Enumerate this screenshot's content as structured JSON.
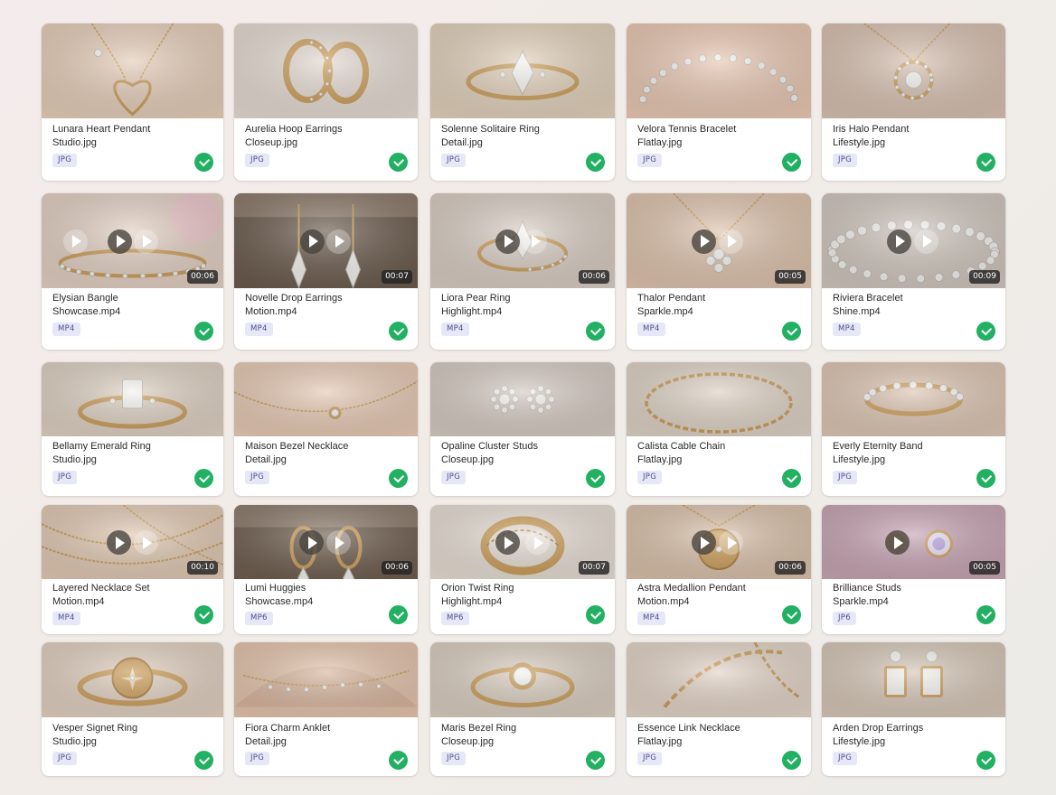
{
  "items": [
    {
      "title": "Lunara Heart Pendant",
      "file": "Studio.jpg",
      "badge": "JPG",
      "video": false,
      "duration": "",
      "bg": "#e5cdb8",
      "motif": "heart"
    },
    {
      "title": "Aurelia Hoop Earrings",
      "file": "Closeup.jpg",
      "badge": "JPG",
      "video": false,
      "duration": "",
      "bg": "#e4dad1",
      "motif": "hoops"
    },
    {
      "title": "Solenne Solitaire Ring",
      "file": "Detail.jpg",
      "badge": "JPG",
      "video": false,
      "duration": "",
      "bg": "#e1d0ba",
      "motif": "ring-marquise"
    },
    {
      "title": "Velora Tennis Bracelet",
      "file": "Flatlay.jpg",
      "badge": "JPG",
      "video": false,
      "duration": "",
      "bg": "#e8c7b2",
      "motif": "bracelet-arc"
    },
    {
      "title": "Iris Halo Pendant",
      "file": "Lifestyle.jpg",
      "badge": "JPG",
      "video": false,
      "duration": "",
      "bg": "#d7c0b0",
      "motif": "halo-pendant"
    },
    {
      "title": "Elysian Bangle",
      "file": "Showcase.mp4",
      "badge": "MP4",
      "video": true,
      "duration": "00:06",
      "bg": "#e2cfc2",
      "motif": "bangle",
      "plays": [
        24,
        73,
        102
      ],
      "ghost": [
        0,
        2
      ]
    },
    {
      "title": "Novelle Drop Earrings",
      "file": "Motion.mp4",
      "badge": "MP4",
      "video": true,
      "duration": "00:07",
      "bg": "#6a5a4c",
      "motif": "drop-earrings",
      "plays": [
        73,
        102
      ],
      "ghost": [
        1
      ]
    },
    {
      "title": "Liora Pear Ring",
      "file": "Highlight.mp4",
      "badge": "MP4",
      "video": true,
      "duration": "00:06",
      "bg": "#d8ccc2",
      "motif": "ring-pear",
      "plays": [
        72,
        102
      ],
      "ghost": [
        1
      ]
    },
    {
      "title": "Thalor Pendant",
      "file": "Sparkle.mp4",
      "badge": "MP4",
      "video": true,
      "duration": "00:05",
      "bg": "#ddc2ac",
      "motif": "flower-pendant",
      "plays": [
        72,
        102
      ],
      "ghost": [
        1
      ]
    },
    {
      "title": "Riviera Bracelet",
      "file": "Shine.mp4",
      "badge": "MP4",
      "video": true,
      "duration": "00:09",
      "bg": "#cfc6bd",
      "motif": "bracelet-round",
      "plays": [
        72,
        102
      ],
      "ghost": [
        1
      ]
    },
    {
      "title": "Bellamy Emerald Ring",
      "file": "Studio.jpg",
      "badge": "JPG",
      "video": false,
      "duration": "",
      "bg": "#ddd0c1",
      "motif": "ring-emerald"
    },
    {
      "title": "Maison Bezel Necklace",
      "file": "Detail.jpg",
      "badge": "JPG",
      "video": false,
      "duration": "",
      "bg": "#e6c9b4",
      "motif": "bezel-necklace"
    },
    {
      "title": "Opaline Cluster Studs",
      "file": "Closeup.jpg",
      "badge": "JPG",
      "video": false,
      "duration": "",
      "bg": "#d4cac1",
      "motif": "cluster-studs"
    },
    {
      "title": "Calista Cable Chain",
      "file": "Flatlay.jpg",
      "badge": "JPG",
      "video": false,
      "duration": "",
      "bg": "#ddd1c4",
      "motif": "chain"
    },
    {
      "title": "Everly Eternity Band",
      "file": "Lifestyle.jpg",
      "badge": "JPG",
      "video": false,
      "duration": "",
      "bg": "#dcc5b2",
      "motif": "eternity-band"
    },
    {
      "title": "Layered Necklace Set",
      "file": "Motion.mp4",
      "badge": "MP4",
      "video": true,
      "duration": "00:10",
      "bg": "#e0c8b2",
      "motif": "layered",
      "plays": [
        72,
        102
      ],
      "ghost": [
        1
      ]
    },
    {
      "title": "Lumi Huggies",
      "file": "Showcase.mp4",
      "badge": "MP6",
      "video": true,
      "duration": "00:06",
      "bg": "#6e5d4e",
      "motif": "huggies",
      "plays": [
        72,
        102
      ],
      "ghost": [
        1
      ]
    },
    {
      "title": "Orion Twist Ring",
      "file": "Highlight.mp4",
      "badge": "MP6",
      "video": true,
      "duration": "00:07",
      "bg": "#e6ddd3",
      "motif": "twist-ring",
      "plays": [
        72,
        105
      ],
      "ghost": [
        1
      ]
    },
    {
      "title": "Astra Medallion Pendant",
      "file": "Motion.mp4",
      "badge": "MP4",
      "video": true,
      "duration": "00:06",
      "bg": "#d9c0a9",
      "motif": "medallion",
      "plays": [
        72,
        102
      ],
      "ghost": [
        1
      ]
    },
    {
      "title": "Brilliance Studs",
      "file": "Sparkle.mp4",
      "badge": "ЈP6",
      "video": true,
      "duration": "00:05",
      "bg": "#c7a4b3",
      "motif": "purple-studs",
      "plays": [
        70
      ],
      "ghost": []
    },
    {
      "title": "Vesper Signet Ring",
      "file": "Studio.jpg",
      "badge": "JPG",
      "video": false,
      "duration": "",
      "bg": "#e0cfbf",
      "motif": "signet"
    },
    {
      "title": "Fiora Charm Anklet",
      "file": "Detail.jpg",
      "badge": "JPG",
      "video": false,
      "duration": "",
      "bg": "#e3c3ab",
      "motif": "anklet"
    },
    {
      "title": "Maris Bezel Ring",
      "file": "Closeup.jpg",
      "badge": "JPG",
      "video": false,
      "duration": "",
      "bg": "#d9cdbf",
      "motif": "bezel-ring"
    },
    {
      "title": "Essence Link Necklace",
      "file": "Flatlay.jpg",
      "badge": "JPG",
      "video": false,
      "duration": "",
      "bg": "#e2d3c6",
      "motif": "link-necklace"
    },
    {
      "title": "Arden Drop Earrings",
      "file": "Lifestyle.jpg",
      "badge": "JPG",
      "video": false,
      "duration": "",
      "bg": "#d5c6b6",
      "motif": "arden-earrings"
    }
  ]
}
